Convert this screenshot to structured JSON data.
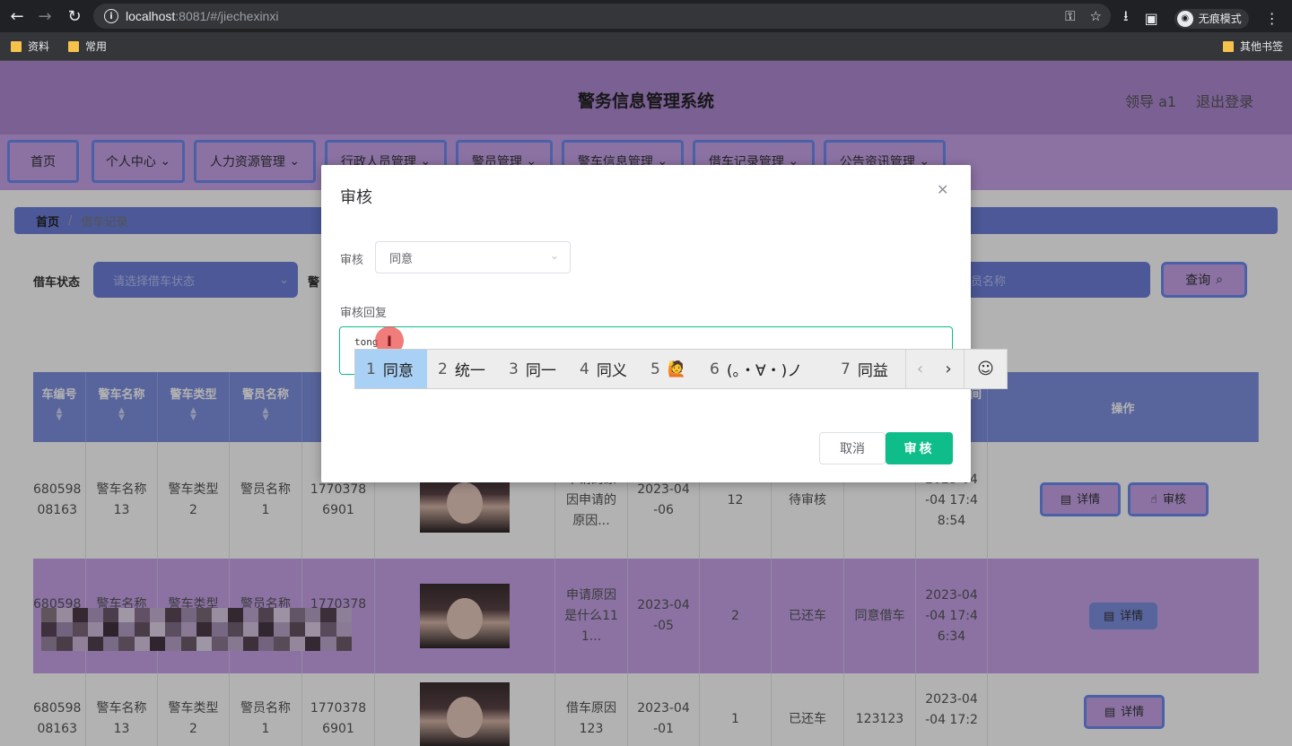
{
  "browser": {
    "url_host": "localhost",
    "url_rest": ":8081/#/jiechexinxi",
    "incognito_label": "无痕模式",
    "bookmarks": [
      "资料",
      "常用"
    ],
    "other_bookmarks": "其他书签"
  },
  "header": {
    "title": "警务信息管理系统",
    "user": "领导 a1",
    "logout": "退出登录"
  },
  "menu": [
    {
      "label": "首页"
    },
    {
      "label": "个人中心"
    },
    {
      "label": "人力资源管理"
    },
    {
      "label": "行政人员管理"
    },
    {
      "label": "警员管理"
    },
    {
      "label": "警车信息管理"
    },
    {
      "label": "借车记录管理"
    },
    {
      "label": "公告资讯管理"
    }
  ],
  "breadcrumb": {
    "home": "首页",
    "current": "借车记录"
  },
  "filters": {
    "status_label": "借车状态",
    "status_placeholder": "请选择借车状态",
    "second_label_partial": "警",
    "name_placeholder_partial": "员名称",
    "query": "查询"
  },
  "table": {
    "headers": [
      "车编号",
      "警车名称",
      "警车类型",
      "警员名称",
      "警",
      "",
      "",
      "",
      "",
      "",
      "间",
      "操作"
    ],
    "rows": [
      {
        "id": "680598\n08163",
        "car_name": "警车名称\n13",
        "car_type": "警车类型\n2",
        "officer": "警员名称\n1",
        "phone": "1770378\n6901",
        "reason": "申请的原\n因申请的\n原因...",
        "date": "2023-04\n-06",
        "days": "12",
        "status": "待审核",
        "reply": "",
        "time": "2023-04\n-04 17:4\n8:54",
        "actions": [
          "详情",
          "审核"
        ]
      },
      {
        "id": "680598\n0",
        "car_name": "警车名称",
        "car_type": "警车类型",
        "officer": "警员名称",
        "phone": "1770378",
        "reason": "申请原因\n是什么11\n1...",
        "date": "2023-04\n-05",
        "days": "2",
        "status": "已还车",
        "reply": "同意借车",
        "time": "2023-04\n-04 17:4\n6:34",
        "actions": [
          "详情"
        ]
      },
      {
        "id": "680598\n08163",
        "car_name": "警车名称\n13",
        "car_type": "警车类型\n2",
        "officer": "警员名称\n1",
        "phone": "1770378\n6901",
        "reason": "借车原因\n123",
        "date": "2023-04\n-01",
        "days": "1",
        "status": "已还车",
        "reply": "123123",
        "time": "2023-04\n-04 17:2",
        "actions": [
          "详情"
        ]
      }
    ]
  },
  "dialog": {
    "title": "审核",
    "audit_label": "审核",
    "audit_value": "同意",
    "reply_label": "审核回复",
    "reply_typing": "tong",
    "cancel": "取消",
    "confirm": "审核"
  },
  "ime": {
    "candidates": [
      {
        "num": "1",
        "text": "同意"
      },
      {
        "num": "2",
        "text": "统一"
      },
      {
        "num": "3",
        "text": "同一"
      },
      {
        "num": "4",
        "text": "同义"
      },
      {
        "num": "5",
        "text": "🙋"
      },
      {
        "num": "6",
        "text": "(。・∀・)ノ"
      },
      {
        "num": "7",
        "text": "同益"
      }
    ],
    "prev": "‹",
    "next": "›",
    "emoji": "☺"
  }
}
